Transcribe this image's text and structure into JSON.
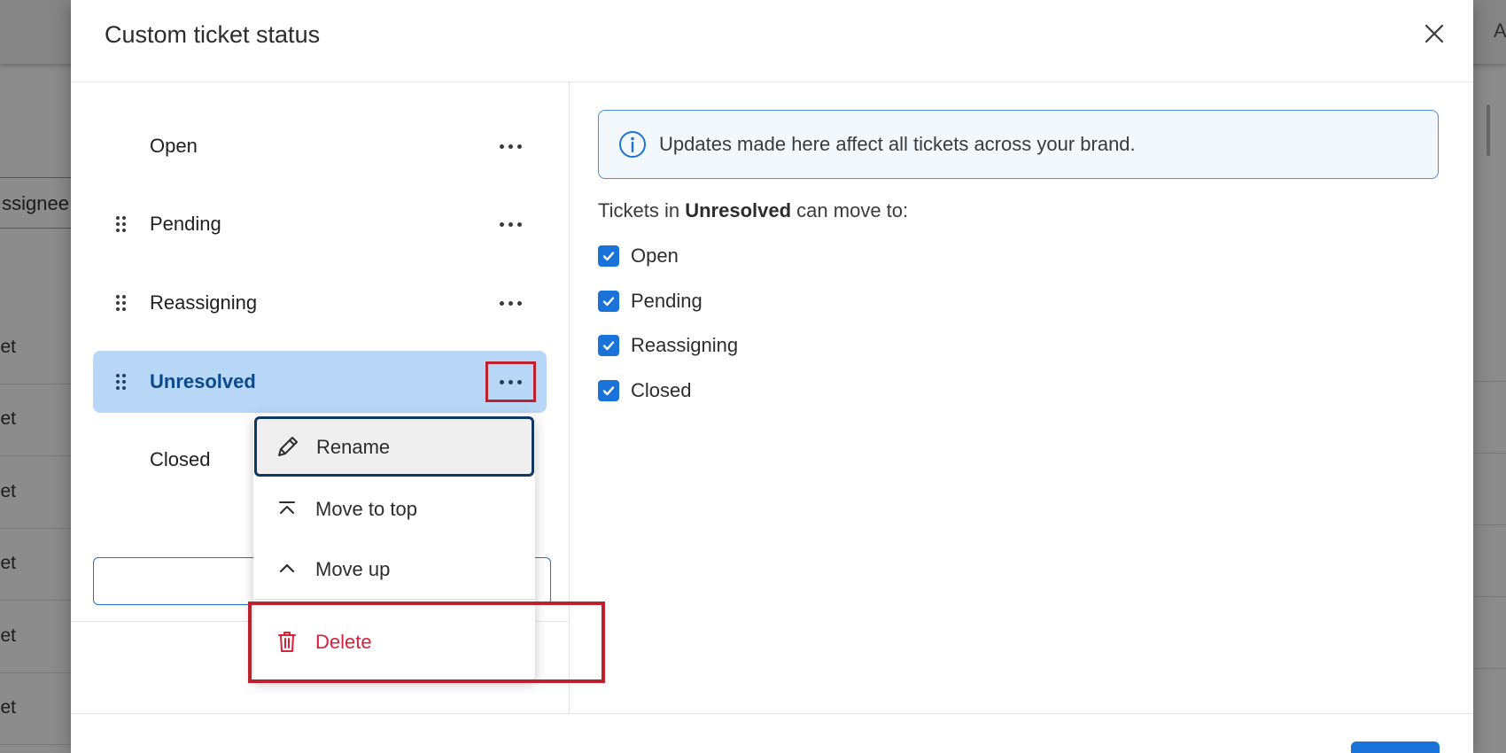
{
  "background": {
    "column_header": "ssignee",
    "row_fragment": "et",
    "topbar_fragment": "A"
  },
  "modal": {
    "title": "Custom ticket status",
    "statuses": [
      {
        "label": "Open",
        "draggable": false,
        "selected": false
      },
      {
        "label": "Pending",
        "draggable": true,
        "selected": false
      },
      {
        "label": "Reassigning",
        "draggable": true,
        "selected": false
      },
      {
        "label": "Unresolved",
        "draggable": true,
        "selected": true
      },
      {
        "label": "Closed",
        "draggable": false,
        "selected": false
      }
    ],
    "context_menu": {
      "items": [
        {
          "label": "Rename",
          "icon": "pencil-icon"
        },
        {
          "label": "Move to top",
          "icon": "move-to-top-icon"
        },
        {
          "label": "Move up",
          "icon": "chevron-up-icon"
        },
        {
          "label": "Delete",
          "icon": "trash-icon"
        }
      ]
    },
    "info_banner": "Updates made here affect all tickets across your brand.",
    "moves": {
      "prefix": "Tickets in",
      "status": "Unresolved",
      "suffix": "can move to:",
      "options": [
        {
          "label": "Open",
          "checked": true
        },
        {
          "label": "Pending",
          "checked": true
        },
        {
          "label": "Reassigning",
          "checked": true
        },
        {
          "label": "Closed",
          "checked": true
        }
      ]
    }
  },
  "colors": {
    "accent": "#1a73d8",
    "selected_row": "#b8d6f5",
    "danger": "#d8203a",
    "highlight_box": "#c0202b"
  }
}
